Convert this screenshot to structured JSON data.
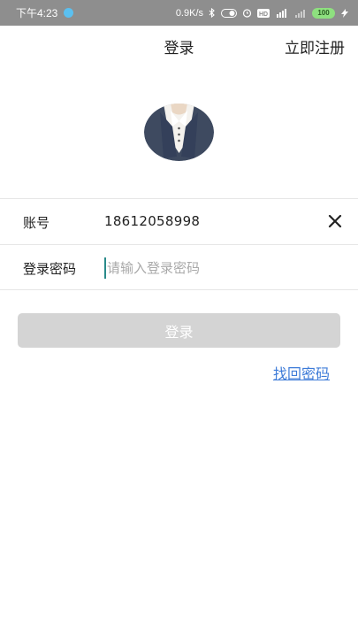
{
  "status_bar": {
    "time": "下午4:23",
    "network_speed": "0.9K/s",
    "battery": "100",
    "hd_badge": "HD"
  },
  "header": {
    "title": "登录",
    "register_label": "立即注册"
  },
  "form": {
    "account_label": "账号",
    "account_value": "18612058998",
    "password_label": "登录密码",
    "password_placeholder": "请输入登录密码"
  },
  "actions": {
    "login_label": "登录",
    "forgot_password_label": "找回密码"
  },
  "colors": {
    "status_bar_bg": "#8e8e8e",
    "login_button_bg": "#d4d4d4",
    "link": "#3d7bd8",
    "divider": "#e6e6e6"
  },
  "icons": {
    "avatar": "user-avatar-icon",
    "clear": "close-icon"
  }
}
